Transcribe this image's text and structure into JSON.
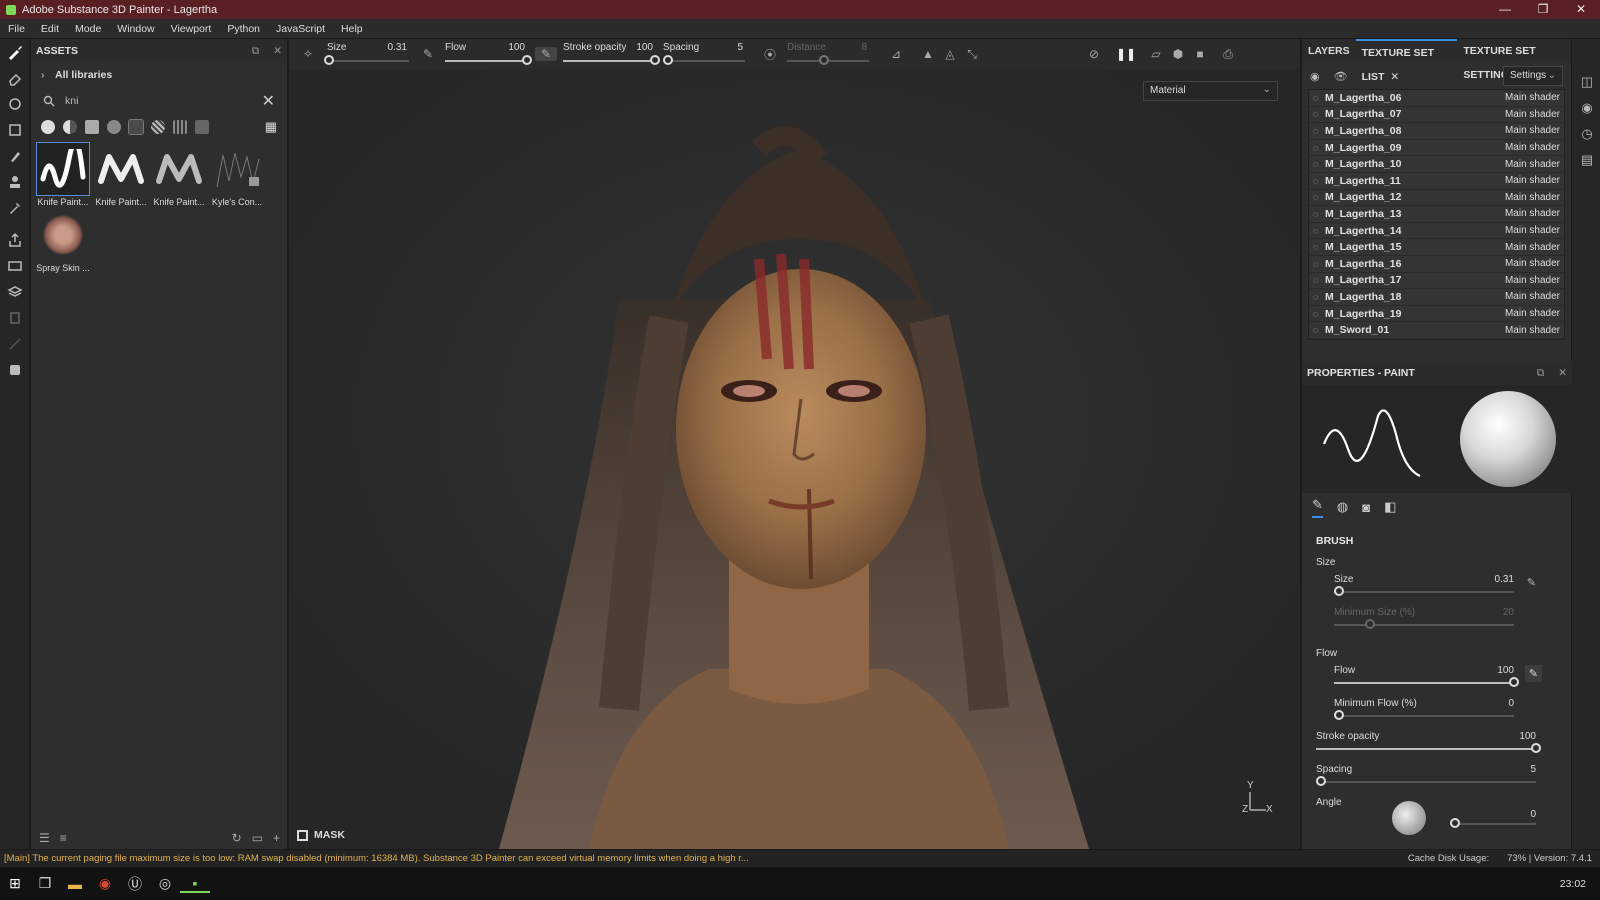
{
  "window": {
    "title": "Adobe Substance 3D Painter - Lagertha",
    "minimize": "—",
    "restore": "❐",
    "close": "✕"
  },
  "menu": [
    "File",
    "Edit",
    "Mode",
    "Window",
    "Viewport",
    "Python",
    "JavaScript",
    "Help"
  ],
  "assets": {
    "title": "ASSETS",
    "libraries": "All libraries",
    "search_query": "kni",
    "items": [
      {
        "label": "Knife Paint...",
        "selected": true
      },
      {
        "label": "Knife Paint...",
        "selected": false
      },
      {
        "label": "Knife Paint...",
        "selected": false
      },
      {
        "label": "Kyle's Con...",
        "selected": false
      },
      {
        "label": "Spray Skin ...",
        "selected": false
      }
    ]
  },
  "toolbar": {
    "size": {
      "label": "Size",
      "value": "0.31",
      "fraction": 0.02
    },
    "flow": {
      "label": "Flow",
      "value": "100",
      "fraction": 1.0
    },
    "stroke_opacity": {
      "label": "Stroke opacity",
      "value": "100",
      "fraction": 1.0
    },
    "spacing": {
      "label": "Spacing",
      "value": "5",
      "fraction": 0.0
    },
    "distance": {
      "label": "Distance",
      "value": "8",
      "fraction": 0.45
    }
  },
  "viewport": {
    "material_mode": "Material",
    "mask_label": "MASK",
    "axis_y": "Y",
    "axis_z": "Z",
    "axis_x": "X"
  },
  "texture_set": {
    "tabs": [
      "LAYERS",
      "TEXTURE SET LIST",
      "TEXTURE SET SETTINGS"
    ],
    "active_tab": "TEXTURE SET LIST",
    "settings_label": "Settings",
    "rows": [
      {
        "name": "M_Lagertha_06",
        "shader": "Main shader"
      },
      {
        "name": "M_Lagertha_07",
        "shader": "Main shader"
      },
      {
        "name": "M_Lagertha_08",
        "shader": "Main shader"
      },
      {
        "name": "M_Lagertha_09",
        "shader": "Main shader"
      },
      {
        "name": "M_Lagertha_10",
        "shader": "Main shader"
      },
      {
        "name": "M_Lagertha_11",
        "shader": "Main shader"
      },
      {
        "name": "M_Lagertha_12",
        "shader": "Main shader"
      },
      {
        "name": "M_Lagertha_13",
        "shader": "Main shader"
      },
      {
        "name": "M_Lagertha_14",
        "shader": "Main shader"
      },
      {
        "name": "M_Lagertha_15",
        "shader": "Main shader"
      },
      {
        "name": "M_Lagertha_16",
        "shader": "Main shader"
      },
      {
        "name": "M_Lagertha_17",
        "shader": "Main shader"
      },
      {
        "name": "M_Lagertha_18",
        "shader": "Main shader"
      },
      {
        "name": "M_Lagertha_19",
        "shader": "Main shader"
      },
      {
        "name": "M_Sword_01",
        "shader": "Main shader"
      }
    ]
  },
  "properties": {
    "title": "PROPERTIES - PAINT",
    "section": "BRUSH",
    "size_group": "Size",
    "size": {
      "label": "Size",
      "value": "0.31",
      "fraction": 0.03
    },
    "min_size": {
      "label": "Minimum Size (%)",
      "value": "20",
      "fraction": 0.2
    },
    "flow_group": "Flow",
    "flow": {
      "label": "Flow",
      "value": "100",
      "fraction": 1.0
    },
    "min_flow": {
      "label": "Minimum Flow (%)",
      "value": "0",
      "fraction": 0.0
    },
    "stroke_opacity": {
      "label": "Stroke opacity",
      "value": "100",
      "fraction": 1.0
    },
    "spacing": {
      "label": "Spacing",
      "value": "5",
      "fraction": 0.0
    },
    "angle": {
      "label": "Angle",
      "value": "0",
      "fraction": 0.0
    }
  },
  "status": {
    "message": "[Main] The current paging file maximum size is too low: RAM swap disabled (minimum: 16384 MB). Substance 3D Painter can exceed virtual memory limits when doing a high r...",
    "cache": "Cache Disk Usage:",
    "cache_value": "73%",
    "version": "| Version: 7.4.1"
  },
  "taskbar": {
    "clock": "23:02"
  }
}
